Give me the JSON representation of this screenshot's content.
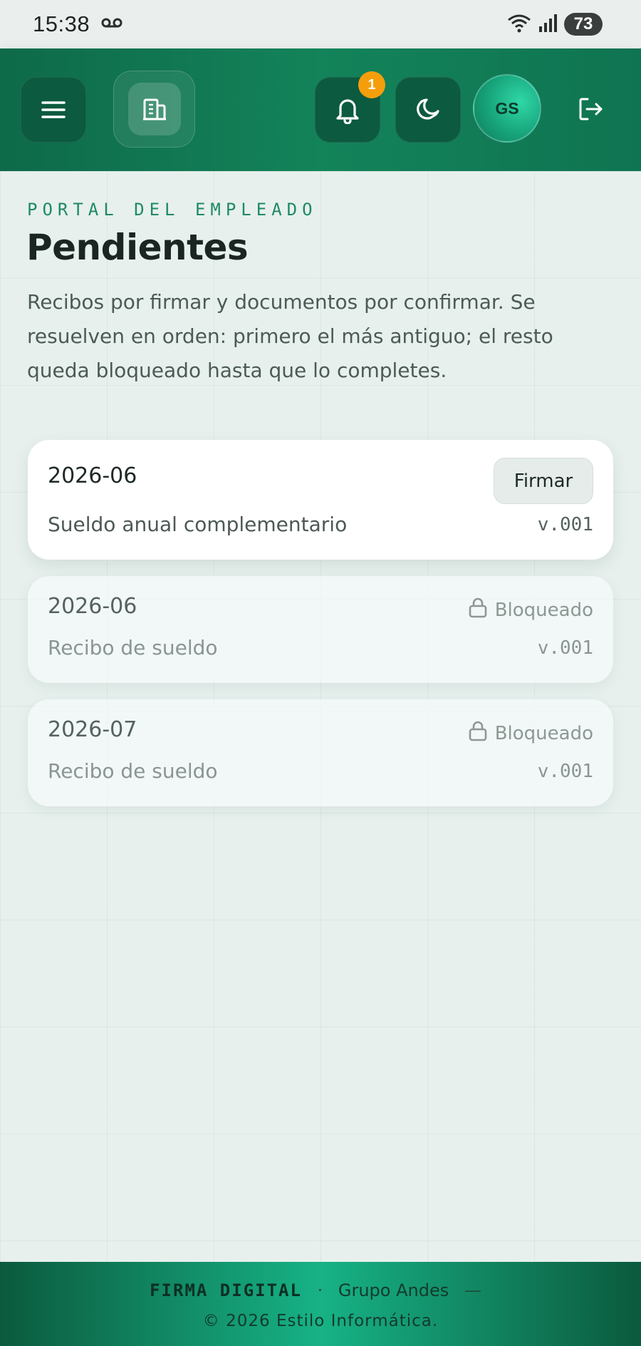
{
  "status_bar": {
    "time": "15:38",
    "battery": "73"
  },
  "header": {
    "notifications_count": "1",
    "avatar_initials": "GS"
  },
  "page": {
    "eyebrow": "PORTAL DEL EMPLEADO",
    "title": "Pendientes",
    "subtitle": "Recibos por firmar y documentos por confirmar. Se resuelven en orden: primero el más antiguo; el resto queda bloqueado hasta que lo completes."
  },
  "items": [
    {
      "period": "2026-06",
      "description": "Sueldo anual complementario",
      "version": "v.001",
      "action": "Firmar"
    },
    {
      "period": "2026-06",
      "description": "Recibo de sueldo",
      "version": "v.001",
      "status": "Bloqueado"
    },
    {
      "period": "2026-07",
      "description": "Recibo de sueldo",
      "version": "v.001",
      "status": "Bloqueado"
    }
  ],
  "footer": {
    "brand": "FIRMA DIGITAL",
    "separator": "·",
    "company": "Grupo Andes",
    "dash": "—",
    "copyright": "© 2026 Estilo Informática."
  },
  "colors": {
    "header_green": "#13835a",
    "accent_green": "#1e8a63",
    "badge_orange": "#f59e0b"
  }
}
